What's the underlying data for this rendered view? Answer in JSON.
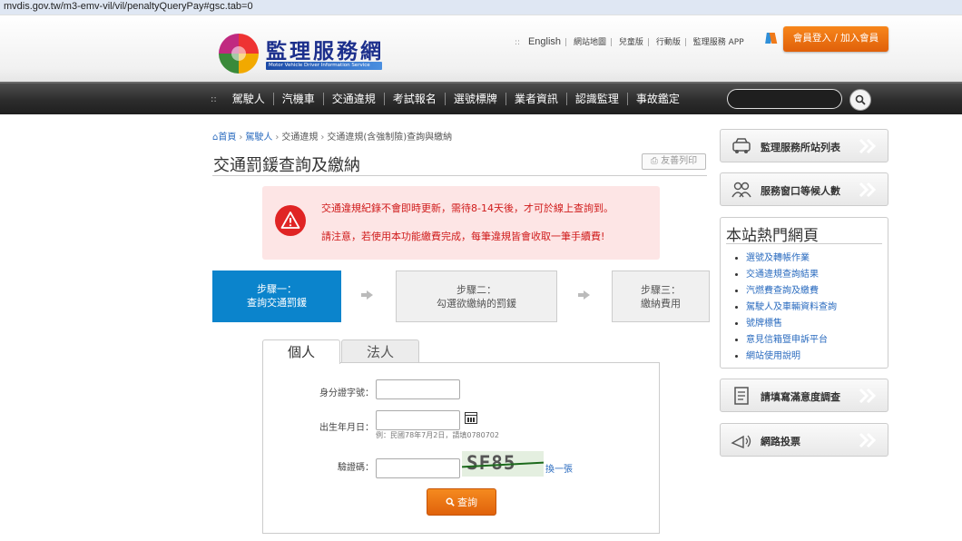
{
  "browser": {
    "url": "mvdis.gov.tw/m3-emv-vil/vil/penaltyQueryPay#gsc.tab=0"
  },
  "header": {
    "logo_name": "監理服務網",
    "logo_subtitle": "Motor Vehicle Driver Information Service",
    "toplinks": [
      "English",
      "網站地圖",
      "兒童版",
      "行動版",
      "監理服務 APP"
    ],
    "login_label": "會員登入 / 加入會員"
  },
  "nav": {
    "items": [
      "駕駛人",
      "汽機車",
      "交通違規",
      "考試報名",
      "選號標牌",
      "業者資訊",
      "認識監理",
      "事故鑑定"
    ]
  },
  "breadcrumb": {
    "home": "首頁",
    "level1": "駕駛人",
    "level2": "交通違規",
    "current": "交通違規(含強制險)查詢與繳納"
  },
  "page": {
    "title": "交通罰鍰查詢及繳納",
    "print_label": "友善列印"
  },
  "alert": {
    "line1": "交通違規紀錄不會即時更新，需待8-14天後，才可於線上查詢到。",
    "line2": "請注意，若使用本功能繳費完成，每筆違規皆會收取一筆手續費!"
  },
  "steps": [
    {
      "line1": "步驟一：",
      "line2": "查詢交通罰鍰"
    },
    {
      "line1": "步驟二：",
      "line2": "勾選欲繳納的罰鍰"
    },
    {
      "line1": "步驟三：",
      "line2": "繳納費用"
    }
  ],
  "tabs": {
    "personal": "個人",
    "corporate": "法人"
  },
  "form": {
    "id_label": "身分證字號：",
    "id_value": "",
    "birth_label": "出生年月日：",
    "birth_value": "",
    "birth_hint": "例：民國78年7月2日，請填0780702",
    "captcha_label": "驗證碼：",
    "captcha_value": "",
    "captcha_text": "SF85",
    "refresh_label": "換一張",
    "query_label": "查詢"
  },
  "sidebar": {
    "station_list": "監理服務所站列表",
    "waiting": "服務窗口等候人數",
    "hot_title": "本站熱門網頁",
    "hot_links": [
      "選號及轉帳作業",
      "交通違規查詢結果",
      "汽燃費查詢及繳費",
      "駕駛人及車輛資料查詢",
      "號牌標售",
      "意見信箱暨申訴平台",
      "網站使用說明"
    ],
    "survey": "請填寫滿意度調查",
    "vote": "網路投票"
  },
  "colors": {
    "accent_blue": "#0b84cc",
    "orange": "#f07a1a",
    "alert_red": "#d01c1c",
    "alert_bg": "#fde5e5",
    "link_blue": "#2a6bbf"
  }
}
